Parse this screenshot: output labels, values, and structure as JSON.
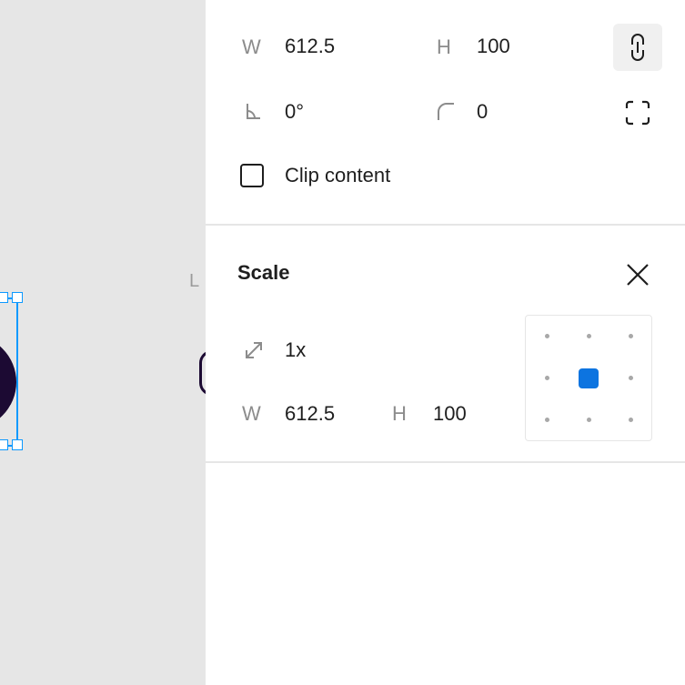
{
  "frame": {
    "w_label": "W",
    "w_value": "612.5",
    "h_label": "H",
    "h_value": "100",
    "rotation_value": "0°",
    "radius_value": "0",
    "clip_content_label": "Clip content",
    "clip_content_checked": false
  },
  "scale": {
    "title": "Scale",
    "factor_value": "1x",
    "w_label": "W",
    "w_value": "612.5",
    "h_label": "H",
    "h_value": "100",
    "anchor_selected": "center"
  },
  "canvas": {
    "ghost_label": "L"
  },
  "colors": {
    "accent": "#0d99ff",
    "anchor_active": "#0d74e0",
    "canvas_bg": "#e6e6e6",
    "shape_fill": "#1c0a33"
  }
}
